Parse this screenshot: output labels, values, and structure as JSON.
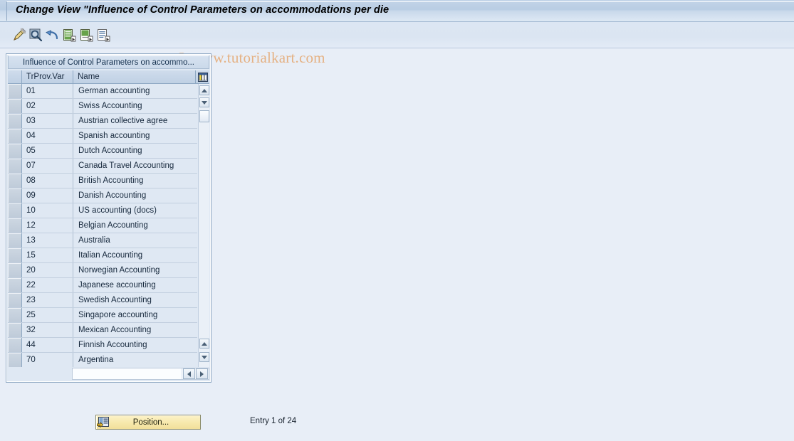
{
  "window": {
    "title": "Change View \"Influence of Control Parameters on accommodations per die"
  },
  "watermark": {
    "text": "© www.tutorialkart.com"
  },
  "toolbar": {
    "buttons": [
      {
        "name": "change-edit-icon",
        "tip": "Change"
      },
      {
        "name": "display-search-icon",
        "tip": "Display"
      },
      {
        "name": "undo-arrow-icon",
        "tip": "Undo"
      },
      {
        "name": "new-entries-icon",
        "tip": "New Entries"
      },
      {
        "name": "copy-as-icon",
        "tip": "Copy As..."
      },
      {
        "name": "details-icon",
        "tip": "Details"
      }
    ]
  },
  "panel": {
    "title": "Influence of Control Parameters on accommo...",
    "columns": [
      "TrProv.Var",
      "Name"
    ],
    "config_icon": "column-config-icon",
    "rows": [
      {
        "key": "01",
        "name": "German accounting"
      },
      {
        "key": "02",
        "name": "Swiss Accounting"
      },
      {
        "key": "03",
        "name": "Austrian collective agree"
      },
      {
        "key": "04",
        "name": "Spanish accounting"
      },
      {
        "key": "05",
        "name": "Dutch Accounting"
      },
      {
        "key": "07",
        "name": "Canada Travel Accounting"
      },
      {
        "key": "08",
        "name": "British Accounting"
      },
      {
        "key": "09",
        "name": "Danish Accounting"
      },
      {
        "key": "10",
        "name": "US accounting (docs)"
      },
      {
        "key": "12",
        "name": "Belgian Accounting"
      },
      {
        "key": "13",
        "name": "Australia"
      },
      {
        "key": "15",
        "name": "Italian Accounting"
      },
      {
        "key": "20",
        "name": "Norwegian Accounting"
      },
      {
        "key": "22",
        "name": "Japanese accounting"
      },
      {
        "key": "23",
        "name": "Swedish Accounting"
      },
      {
        "key": "25",
        "name": "Singapore accounting"
      },
      {
        "key": "32",
        "name": "Mexican Accounting"
      },
      {
        "key": "44",
        "name": "Finnish Accounting"
      },
      {
        "key": "70",
        "name": "Argentina"
      }
    ]
  },
  "footer": {
    "position_label": "Position...",
    "entry_status": "Entry 1 of 24"
  },
  "colors": {
    "background": "#e8eef7",
    "title_bar": "#bdd0e6",
    "table_row": "#dfe8f3",
    "button_yellow": "#f7e9ae",
    "watermark": "#e5b183"
  }
}
